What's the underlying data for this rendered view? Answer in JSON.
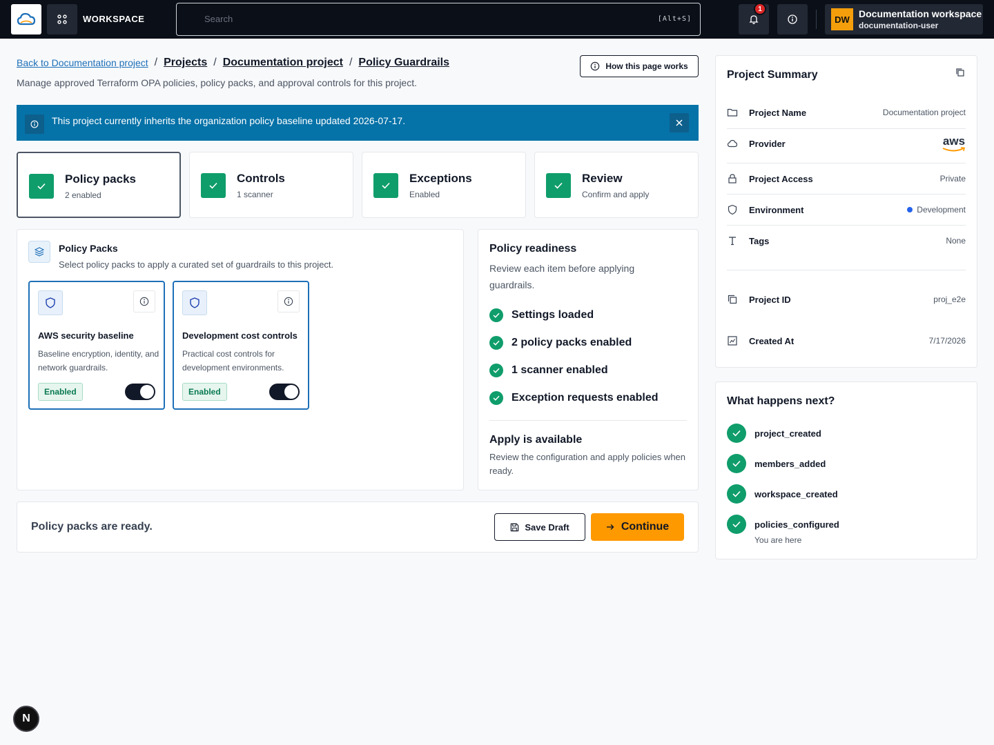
{
  "topbar": {
    "workspace_label": "WORKSPACE",
    "search_placeholder": "Search",
    "search_shortcut": "[Alt+S]",
    "notification_count": "1",
    "user_initials": "DW",
    "user_name": "Documentation workspace",
    "user_sub": "documentation-user"
  },
  "breadcrumb": {
    "back": "Back to Documentation project",
    "items": [
      "Projects",
      "Documentation project",
      "Policy Guardrails"
    ],
    "separator": "/"
  },
  "page": {
    "subtitle": "Manage approved Terraform OPA policies, policy packs, and approval controls for this project.",
    "how_button": "How this page works"
  },
  "banner": {
    "text": "This project currently inherits the organization policy baseline updated 2026-07-17."
  },
  "steps": [
    {
      "title": "Policy packs",
      "sub": "2 enabled"
    },
    {
      "title": "Controls",
      "sub": "1 scanner"
    },
    {
      "title": "Exceptions",
      "sub": "Enabled"
    },
    {
      "title": "Review",
      "sub": "Confirm and apply"
    }
  ],
  "policy_packs": {
    "title": "Policy Packs",
    "subtitle": "Select policy packs to apply a curated set of guardrails to this project.",
    "packs": [
      {
        "title": "AWS security baseline",
        "desc": "Baseline encryption, identity, and network guardrails.",
        "status": "Enabled",
        "enabled": true
      },
      {
        "title": "Development cost controls",
        "desc": "Practical cost controls for development environments.",
        "status": "Enabled",
        "enabled": true
      }
    ]
  },
  "readiness": {
    "title": "Policy readiness",
    "subtitle": "Review each item before applying guardrails.",
    "items": [
      "Settings loaded",
      "2 policy packs enabled",
      "1 scanner enabled",
      "Exception requests enabled"
    ],
    "apply_title": "Apply is available",
    "apply_sub": "Review the configuration and apply policies when ready."
  },
  "bottom_bar": {
    "status": "Policy packs are ready.",
    "save_label": "Save Draft",
    "continue_label": "Continue"
  },
  "summary": {
    "title": "Project Summary",
    "rows": [
      {
        "label": "Project Name",
        "value": "Documentation project"
      },
      {
        "label": "Provider",
        "value": "aws"
      },
      {
        "label": "Project Access",
        "value": "Private"
      },
      {
        "label": "Environment",
        "value": "Development"
      },
      {
        "label": "Tags",
        "value": "None"
      },
      {
        "label": "Project ID",
        "value": "proj_e2e"
      },
      {
        "label": "Created At",
        "value": "7/17/2026"
      }
    ]
  },
  "next_steps": {
    "title": "What happens next?",
    "items": [
      "project_created",
      "members_added",
      "workspace_created",
      "policies_configured"
    ],
    "current_note": "You are here"
  },
  "dev_badge": "N",
  "colors": {
    "accent": "#ff9900",
    "success": "#0f9d6b",
    "banner": "#0572a8",
    "link": "#1d6fb8",
    "topbar": "#0b0f17"
  }
}
